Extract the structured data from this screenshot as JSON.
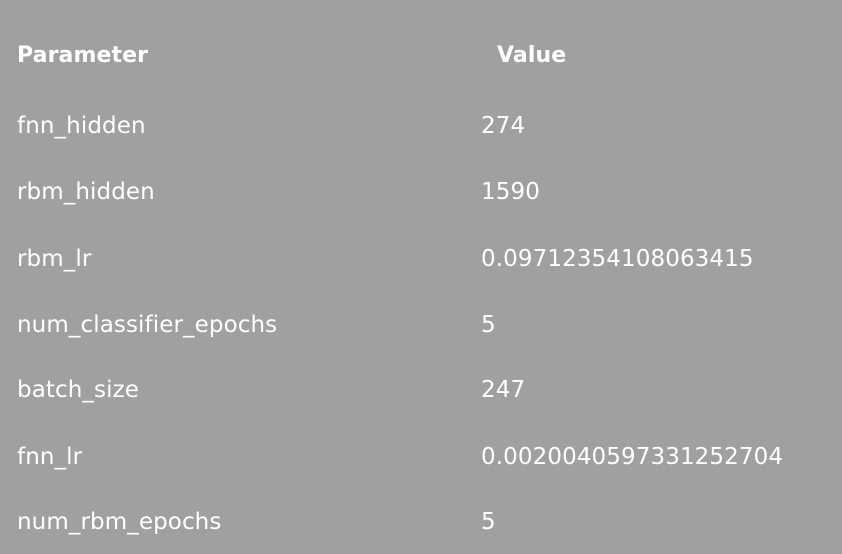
{
  "table": {
    "header": {
      "parameter": "Parameter",
      "value": "Value"
    },
    "rows": [
      {
        "parameter": "fnn_hidden",
        "value": "274"
      },
      {
        "parameter": "rbm_hidden",
        "value": "1590"
      },
      {
        "parameter": "rbm_lr",
        "value": "0.09712354108063415"
      },
      {
        "parameter": "num_classifier_epochs",
        "value": "5"
      },
      {
        "parameter": "batch_size",
        "value": "247"
      },
      {
        "parameter": "fnn_lr",
        "value": "0.0020040597331252704"
      },
      {
        "parameter": "num_rbm_epochs",
        "value": "5"
      }
    ]
  }
}
